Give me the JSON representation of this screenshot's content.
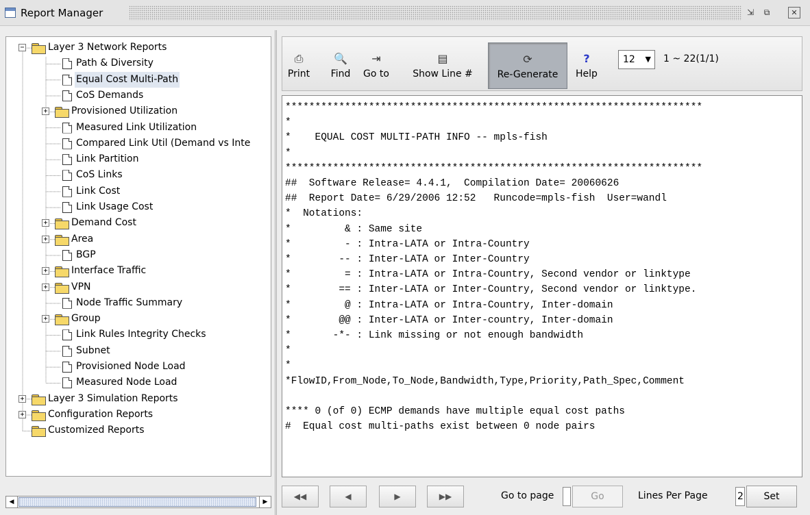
{
  "window": {
    "title": "Report Manager",
    "controls": {
      "restore": "⇲",
      "maximize": "⧉",
      "close": "✕"
    }
  },
  "tree": {
    "items": [
      {
        "label": "Layer 3 Network Reports",
        "type": "folder",
        "expander": "−"
      },
      {
        "label": "Path & Diversity",
        "type": "doc"
      },
      {
        "label": "Equal Cost Multi-Path",
        "type": "doc",
        "selected": true
      },
      {
        "label": "CoS Demands",
        "type": "doc"
      },
      {
        "label": "Provisioned Utilization",
        "type": "folder",
        "expander": "+"
      },
      {
        "label": "Measured Link Utilization",
        "type": "doc"
      },
      {
        "label": "Compared Link Util (Demand vs Inte",
        "type": "doc"
      },
      {
        "label": "Link Partition",
        "type": "doc"
      },
      {
        "label": "CoS Links",
        "type": "doc"
      },
      {
        "label": "Link Cost",
        "type": "doc"
      },
      {
        "label": "Link Usage Cost",
        "type": "doc"
      },
      {
        "label": "Demand Cost",
        "type": "folder",
        "expander": "+"
      },
      {
        "label": "Area",
        "type": "folder",
        "expander": "+"
      },
      {
        "label": "BGP",
        "type": "doc"
      },
      {
        "label": "Interface Traffic",
        "type": "folder",
        "expander": "+"
      },
      {
        "label": "VPN",
        "type": "folder",
        "expander": "+"
      },
      {
        "label": "Node Traffic Summary",
        "type": "doc"
      },
      {
        "label": "Group",
        "type": "folder",
        "expander": "+"
      },
      {
        "label": "Link Rules Integrity Checks",
        "type": "doc"
      },
      {
        "label": "Subnet",
        "type": "doc"
      },
      {
        "label": "Provisioned Node Load",
        "type": "doc"
      },
      {
        "label": "Measured Node Load",
        "type": "doc"
      },
      {
        "label": "Layer 3 Simulation Reports",
        "type": "folder",
        "expander": "+"
      },
      {
        "label": "Configuration Reports",
        "type": "folder",
        "expander": "+"
      },
      {
        "label": "Customized Reports",
        "type": "folder"
      }
    ]
  },
  "toolbar": {
    "print": "Print",
    "find": "Find",
    "goto": "Go to",
    "show_line": "Show Line #",
    "regenerate": "Re-Generate",
    "help": "Help",
    "page_select": "12",
    "range": "1 ~ 22(1/1)",
    "icons": {
      "print": "⎙",
      "find": "🔍",
      "goto": "⇥",
      "show_line": "▤",
      "regenerate": "⟳",
      "help": "?"
    }
  },
  "report": {
    "lines": [
      "**********************************************************************",
      "*",
      "*    EQUAL COST MULTI-PATH INFO -- mpls-fish",
      "*",
      "**********************************************************************",
      "##  Software Release= 4.4.1,  Compilation Date= 20060626",
      "##  Report Date= 6/29/2006 12:52   Runcode=mpls-fish  User=wandl",
      "*  Notations:",
      "*         & : Same site",
      "*         - : Intra-LATA or Intra-Country",
      "*        -- : Inter-LATA or Inter-Country",
      "*         = : Intra-LATA or Intra-Country, Second vendor or linktype",
      "*        == : Inter-LATA or Inter-Country, Second vendor or linktype.",
      "*         @ : Intra-LATA or Intra-Country, Inter-domain",
      "*        @@ : Inter-LATA or Inter-country, Inter-domain",
      "*       -*- : Link missing or not enough bandwidth",
      "*",
      "*",
      "*FlowID,From_Node,To_Node,Bandwidth,Type,Priority,Path_Spec,Comment",
      "",
      "**** 0 (of 0) ECMP demands have multiple equal cost paths",
      "#  Equal cost multi-paths exist between 0 node pairs"
    ]
  },
  "bottom": {
    "first": "◀◀",
    "prev": "◀",
    "next": "▶",
    "last": "▶▶",
    "goto_label": "Go to page",
    "go": "Go",
    "lines_per_page_label": "Lines Per Page",
    "lines_per_page_value": "2",
    "set": "Set"
  },
  "scrollbar": {
    "left_arrow": "◀",
    "right_arrow": "▶"
  }
}
